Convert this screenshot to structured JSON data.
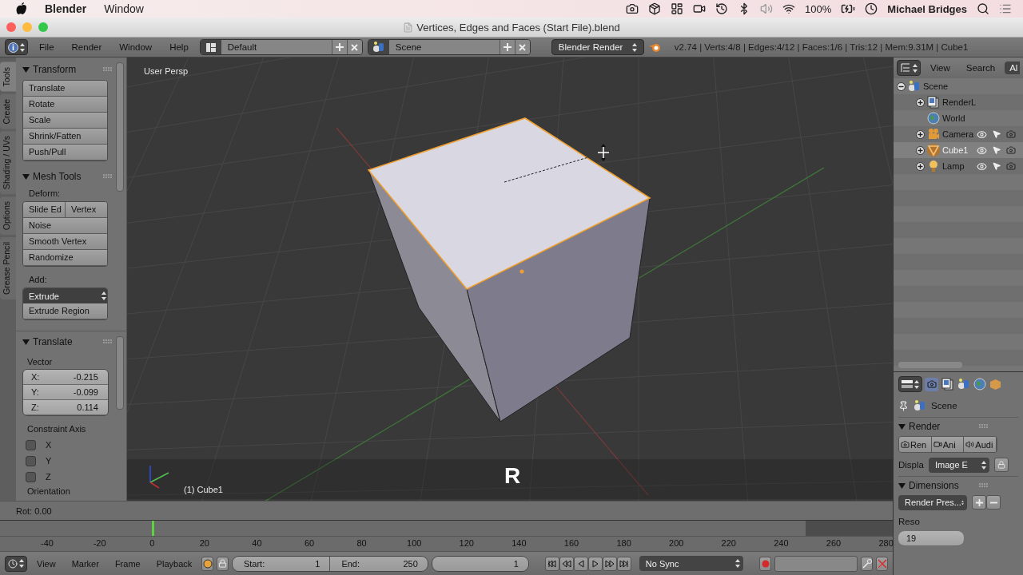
{
  "menubar": {
    "app": "Blender",
    "menus": [
      "Window"
    ],
    "battery": "100%",
    "user": "Michael Bridges"
  },
  "window": {
    "title": "Vertices, Edges and Faces (Start File).blend"
  },
  "info_header": {
    "menus": [
      "File",
      "Render",
      "Window",
      "Help"
    ],
    "layout": "Default",
    "scene": "Scene",
    "engine": "Blender Render",
    "stats": "v2.74 | Verts:4/8 | Edges:4/12 | Faces:1/6 | Tris:12 | Mem:9.31M | Cube1"
  },
  "tool_tabs": [
    {
      "label": "Tools",
      "selected": true
    },
    {
      "label": "Create",
      "selected": false
    },
    {
      "label": "Shading / UVs",
      "selected": false
    },
    {
      "label": "Options",
      "selected": false
    },
    {
      "label": "Grease Pencil",
      "selected": false
    }
  ],
  "transform_panel": {
    "title": "Transform",
    "expanded": true,
    "buttons": [
      "Translate",
      "Rotate",
      "Scale",
      "Shrink/Fatten",
      "Push/Pull"
    ]
  },
  "mesh_tools_panel": {
    "title": "Mesh Tools",
    "expanded": true,
    "deform_label": "Deform:",
    "deform_rows": [
      [
        "Slide Ed",
        "Vertex"
      ],
      [
        "Noise"
      ],
      [
        "Smooth Vertex"
      ],
      [
        "Randomize"
      ]
    ],
    "add_label": "Add:",
    "extrude_dropdown": "Extrude",
    "add_buttons": [
      "Extrude Region"
    ]
  },
  "operator_panel": {
    "title": "Translate",
    "expanded": true,
    "vector_label": "Vector",
    "fields": [
      {
        "label": "X:",
        "value": "-0.215"
      },
      {
        "label": "Y:",
        "value": "-0.099"
      },
      {
        "label": "Z:",
        "value": "0.114"
      }
    ],
    "constraint_label": "Constraint Axis",
    "constraints": [
      {
        "label": "X",
        "checked": false
      },
      {
        "label": "Y",
        "checked": false
      },
      {
        "label": "Z",
        "checked": false
      }
    ],
    "orientation_label": "Orientation"
  },
  "viewport": {
    "view_label": "User Persp",
    "object_label": "(1) Cube1",
    "key_overlay": "R"
  },
  "status_line": "Rot: 0.00",
  "timeline": {
    "ticks": [
      "-40",
      "-20",
      "0",
      "20",
      "40",
      "60",
      "80",
      "100",
      "120",
      "140",
      "160",
      "180",
      "200",
      "220",
      "240",
      "260",
      "280"
    ],
    "menus": [
      "View",
      "Marker",
      "Frame",
      "Playback"
    ],
    "start_label": "Start:",
    "start": "1",
    "end_label": "End:",
    "end": "250",
    "current": "1",
    "sync": "No Sync"
  },
  "outliner": {
    "menus": [
      "View",
      "Search"
    ],
    "display_mode": "Al",
    "tree": [
      {
        "label": "Scene",
        "kind": "scene",
        "expanded": true,
        "selected": false,
        "children": [
          {
            "label": "RenderL",
            "kind": "renderlayers",
            "expanded": false,
            "selected": false
          },
          {
            "label": "World",
            "kind": "world",
            "selected": false
          },
          {
            "label": "Camera",
            "kind": "camera",
            "expanded": false,
            "selected": false
          },
          {
            "label": "Cube1",
            "kind": "mesh",
            "expanded": false,
            "selected": true
          },
          {
            "label": "Lamp",
            "kind": "lamp",
            "expanded": false,
            "selected": false
          }
        ]
      }
    ]
  },
  "properties": {
    "scene": "Scene",
    "render_panel": {
      "title": "Render",
      "expanded": true,
      "buttons": [
        "Ren",
        "Ani",
        "Audi"
      ],
      "display_label": "Displa",
      "display_value": "Image E"
    },
    "dimensions_panel": {
      "title": "Dimensions",
      "expanded": true,
      "preset": "Render Pres...",
      "resolution_label": "Reso",
      "resolution_value": "19"
    }
  }
}
